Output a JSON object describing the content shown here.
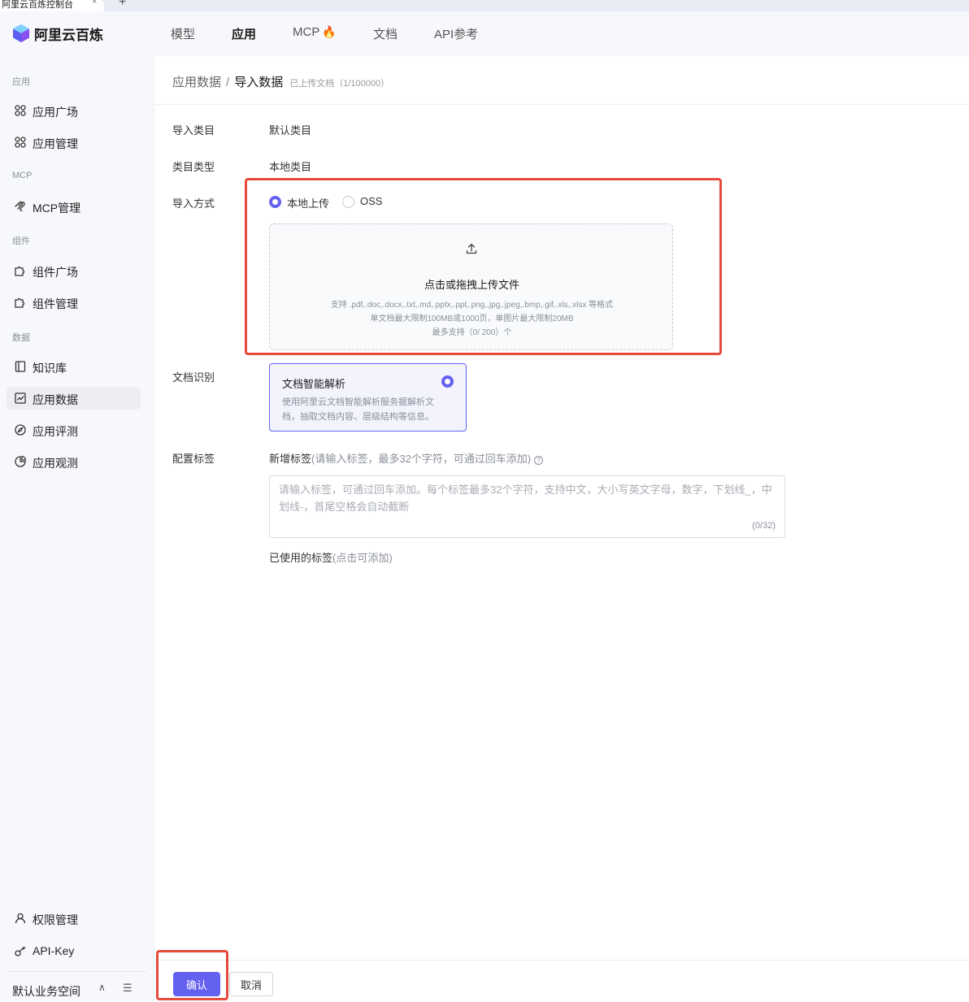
{
  "browser": {
    "tab_title": "阿里云百炼控制台",
    "tab_close": "×",
    "new_tab": "+"
  },
  "header": {
    "brand": "阿里云百炼",
    "nav": [
      {
        "label": "模型",
        "active": false
      },
      {
        "label": "应用",
        "active": true
      },
      {
        "label": "MCP",
        "active": false
      },
      {
        "label": "文档",
        "active": false
      },
      {
        "label": "API参考",
        "active": false
      }
    ]
  },
  "sidebar": {
    "sections": {
      "app": "应用",
      "mcp": "MCP",
      "component": "组件",
      "data": "数据"
    },
    "items": [
      {
        "label": "应用广场",
        "icon": "grid-icon"
      },
      {
        "label": "应用管理",
        "icon": "grid-icon"
      },
      {
        "label": "MCP管理",
        "icon": "mcp-icon"
      },
      {
        "label": "组件广场",
        "icon": "puzzle-icon"
      },
      {
        "label": "组件管理",
        "icon": "puzzle-icon"
      },
      {
        "label": "知识库",
        "icon": "book-icon"
      },
      {
        "label": "应用数据",
        "icon": "chart-icon",
        "active": true
      },
      {
        "label": "应用评测",
        "icon": "compass-icon"
      },
      {
        "label": "应用观测",
        "icon": "pie-icon"
      },
      {
        "label": "权限管理",
        "icon": "user-icon"
      },
      {
        "label": "API-Key",
        "icon": "key-icon"
      }
    ],
    "workspace": "默认业务空间"
  },
  "breadcrumb": {
    "parent": "应用数据",
    "separator": "/",
    "current": "导入数据",
    "subtitle": "已上传文档（1/100000）"
  },
  "form": {
    "category_label": "导入类目",
    "category_value": "默认类目",
    "category_type_label": "类目类型",
    "category_type_value": "本地类目",
    "import_method_label": "导入方式",
    "import_options": [
      {
        "label": "本地上传",
        "selected": true
      },
      {
        "label": "OSS",
        "selected": false
      }
    ],
    "upload": {
      "title": "点击或拖拽上传文件",
      "formats": "支持 .pdf,.doc,.docx,.txt,.md,.pptx,.ppt,.png,.jpg,.jpeg,.bmp,.gif,.xls,.xlsx 等格式",
      "limits": "单文档最大限制100MB或1000页，单图片最大限制20MB",
      "max_count": "最多支持（0/ 200）个"
    },
    "doc_recognition_label": "文档识别",
    "doc_card": {
      "title": "文档智能解析",
      "desc": "使用阿里云文档智能解析服务据解析文档，抽取文档内容、层级结构等信息。",
      "selected": true
    },
    "tag_label": "配置标签",
    "tag_heading": "新增标签",
    "tag_hint": "(请输入标签，最多32个字符，可通过回车添加)",
    "tag_help": "?",
    "tag_placeholder": "请输入标签，可通过回车添加。每个标签最多32个字符，支持中文，大小写英文字母，数字，下划线_，中划线-，首尾空格会自动截断",
    "tag_counter": "(0/32)",
    "used_tags": "已使用的标签",
    "used_tags_hint": "(点击可添加)"
  },
  "footer": {
    "confirm": "确认",
    "cancel": "取消"
  },
  "colors": {
    "accent": "#6461f0",
    "highlight": "#e64a3b"
  }
}
